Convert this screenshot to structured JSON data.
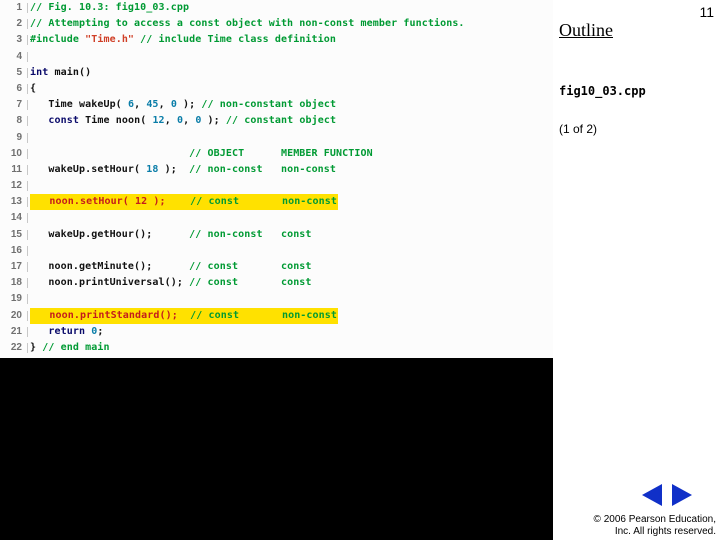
{
  "slide_number": "11",
  "outline_heading": "Outline",
  "file_label": "fig10_03.cpp",
  "part_label": "(1 of 2)",
  "copyright_line1": "© 2006 Pearson Education,",
  "copyright_line2": "Inc.  All rights reserved.",
  "code": {
    "lines": [
      {
        "n": "1",
        "tokens": [
          {
            "cls": "c-comment",
            "t": "// Fig. 10.3: fig10_03.cpp"
          }
        ]
      },
      {
        "n": "2",
        "tokens": [
          {
            "cls": "c-comment",
            "t": "// Attempting to access a const object with non-const member functions."
          }
        ]
      },
      {
        "n": "3",
        "tokens": [
          {
            "cls": "c-pp",
            "t": "#include "
          },
          {
            "cls": "c-str",
            "t": "\"Time.h\""
          },
          {
            "cls": "c-comment",
            "t": " // include Time class definition"
          }
        ]
      },
      {
        "n": "4",
        "tokens": []
      },
      {
        "n": "5",
        "tokens": [
          {
            "cls": "c-key",
            "t": "int"
          },
          {
            "cls": "c-text",
            "t": " main()"
          }
        ]
      },
      {
        "n": "6",
        "tokens": [
          {
            "cls": "c-text",
            "t": "{"
          }
        ]
      },
      {
        "n": "7",
        "tokens": [
          {
            "cls": "c-text",
            "t": "   Time wakeUp( "
          },
          {
            "cls": "c-num",
            "t": "6"
          },
          {
            "cls": "c-text",
            "t": ", "
          },
          {
            "cls": "c-num",
            "t": "45"
          },
          {
            "cls": "c-text",
            "t": ", "
          },
          {
            "cls": "c-num",
            "t": "0"
          },
          {
            "cls": "c-text",
            "t": " ); "
          },
          {
            "cls": "c-comment",
            "t": "// non-constant object"
          }
        ]
      },
      {
        "n": "8",
        "tokens": [
          {
            "cls": "c-text",
            "t": "   "
          },
          {
            "cls": "c-key",
            "t": "const"
          },
          {
            "cls": "c-text",
            "t": " Time noon( "
          },
          {
            "cls": "c-num",
            "t": "12"
          },
          {
            "cls": "c-text",
            "t": ", "
          },
          {
            "cls": "c-num",
            "t": "0"
          },
          {
            "cls": "c-text",
            "t": ", "
          },
          {
            "cls": "c-num",
            "t": "0"
          },
          {
            "cls": "c-text",
            "t": " ); "
          },
          {
            "cls": "c-comment",
            "t": "// constant object"
          }
        ]
      },
      {
        "n": "9",
        "tokens": []
      },
      {
        "n": "10",
        "tokens": [
          {
            "cls": "c-text",
            "t": "                          "
          },
          {
            "cls": "c-comment",
            "t": "// OBJECT      MEMBER FUNCTION"
          }
        ]
      },
      {
        "n": "11",
        "tokens": [
          {
            "cls": "c-text",
            "t": "   wakeUp.setHour( "
          },
          {
            "cls": "c-num",
            "t": "18"
          },
          {
            "cls": "c-text",
            "t": " );  "
          },
          {
            "cls": "c-comment",
            "t": "// non-const   non-const"
          }
        ]
      },
      {
        "n": "12",
        "tokens": []
      },
      {
        "n": "13",
        "hl": true,
        "tokens": [
          {
            "cls": "c-err",
            "t": "   noon.setHour( 12 );    "
          },
          {
            "cls": "c-comment",
            "t": "// const       non-const"
          }
        ]
      },
      {
        "n": "14",
        "tokens": []
      },
      {
        "n": "15",
        "tokens": [
          {
            "cls": "c-text",
            "t": "   wakeUp.getHour();      "
          },
          {
            "cls": "c-comment",
            "t": "// non-const   const"
          }
        ]
      },
      {
        "n": "16",
        "tokens": []
      },
      {
        "n": "17",
        "tokens": [
          {
            "cls": "c-text",
            "t": "   noon.getMinute();      "
          },
          {
            "cls": "c-comment",
            "t": "// const       const"
          }
        ]
      },
      {
        "n": "18",
        "tokens": [
          {
            "cls": "c-text",
            "t": "   noon.printUniversal(); "
          },
          {
            "cls": "c-comment",
            "t": "// const       const"
          }
        ]
      },
      {
        "n": "19",
        "tokens": []
      },
      {
        "n": "20",
        "hl": true,
        "tokens": [
          {
            "cls": "c-err",
            "t": "   noon.printStandard();  "
          },
          {
            "cls": "c-comment",
            "t": "// const       non-const"
          }
        ]
      },
      {
        "n": "21",
        "tokens": [
          {
            "cls": "c-text",
            "t": "   "
          },
          {
            "cls": "c-key",
            "t": "return"
          },
          {
            "cls": "c-text",
            "t": " "
          },
          {
            "cls": "c-num",
            "t": "0"
          },
          {
            "cls": "c-text",
            "t": ";"
          }
        ]
      },
      {
        "n": "22",
        "tokens": [
          {
            "cls": "c-text",
            "t": "} "
          },
          {
            "cls": "c-comment",
            "t": "// end main"
          }
        ]
      }
    ]
  }
}
